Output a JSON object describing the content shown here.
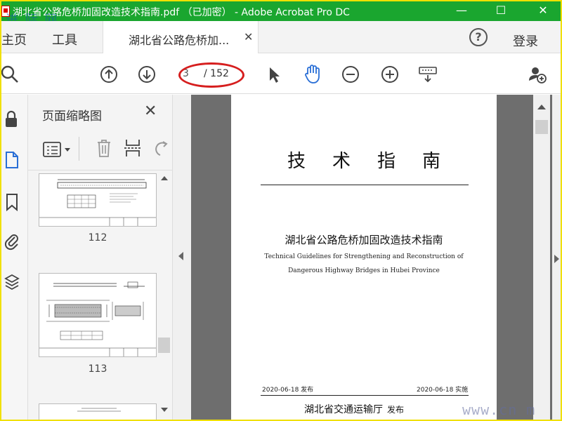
{
  "window": {
    "title": "湖北省公路危桥加固改造技术指南.pdf （已加密） - Adobe Acrobat Pro DC",
    "minimize": "—",
    "maximize": "☐",
    "close": "✕",
    "watermark_top": "进 际 网"
  },
  "tabs": {
    "home": "主页",
    "tools": "工具",
    "doc_tab": "湖北省公路危桥加...",
    "doc_tab_close": "✕",
    "help": "?",
    "login": "登录"
  },
  "toolbar": {
    "current_page": "3",
    "total_pages": "/ 152"
  },
  "thumbnails": {
    "title": "页面缩略图",
    "close": "✕",
    "pages": [
      {
        "number": "112"
      },
      {
        "number": "113"
      }
    ]
  },
  "document": {
    "heading": "技术指南",
    "title_cn": "湖北省公路危桥加固改造技术指南",
    "title_en_1": "Technical Guidelines for Strengthening and Reconstruction of",
    "title_en_2": "Dangerous Highway Bridges in Hubei Province",
    "publish_date": "2020-06-18 发布",
    "effective_date": "2020-06-18 实施",
    "publisher": "湖北省交通运输厅",
    "publisher_suffix": "发布"
  },
  "watermark_bottom": "www.cn    m",
  "colors": {
    "titlebar": "#1aa62f",
    "frame": "#f0e000",
    "annotation": "#d61e1e",
    "hand_tool": "#2a6fd6"
  }
}
